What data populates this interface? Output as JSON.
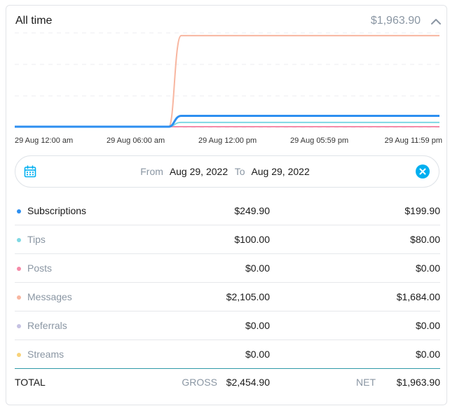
{
  "header": {
    "title": "All time",
    "total": "$1,963.90"
  },
  "chart_data": {
    "type": "line",
    "x_ticks": [
      "29 Aug 12:00 am",
      "29 Aug 06:00 am",
      "29 Aug 12:00 pm",
      "29 Aug 05:59 pm",
      "29 Aug 11:59 pm"
    ],
    "x": [
      "29 Aug 12:00 am",
      "29 Aug 06:00 am",
      "29 Aug 08:00 am",
      "29 Aug 10:00 am",
      "29 Aug 12:00 pm",
      "29 Aug 05:59 pm",
      "29 Aug 11:59 pm"
    ],
    "ylim": [
      0,
      2200
    ],
    "grid": true,
    "series": [
      {
        "name": "Messages",
        "color": "#f8b6a0",
        "values": [
          0,
          0,
          0,
          2105,
          2105,
          2105,
          2105
        ]
      },
      {
        "name": "Subscriptions",
        "color": "#2d8ff0",
        "values": [
          0,
          0,
          0,
          249.9,
          249.9,
          249.9,
          249.9
        ]
      },
      {
        "name": "Tips",
        "color": "#7fd8e3",
        "values": [
          0,
          0,
          0,
          100,
          100,
          100,
          100
        ]
      },
      {
        "name": "Posts",
        "color": "#f58aa8",
        "values": [
          0,
          0,
          0,
          0,
          0,
          0,
          0
        ]
      }
    ]
  },
  "daterange": {
    "from_label": "From",
    "from_value": "Aug 29, 2022",
    "to_label": "To",
    "to_value": "Aug 29, 2022",
    "calendar_icon": "calendar-icon",
    "clear_icon": "close-circle-icon"
  },
  "rows": [
    {
      "name": "Subscriptions",
      "color": "#2d8ff0",
      "name_color": "#1a1a1a",
      "gross": "$249.90",
      "net": "$199.90"
    },
    {
      "name": "Tips",
      "color": "#7fd8e3",
      "name_color": "#8a96a3",
      "gross": "$100.00",
      "net": "$80.00"
    },
    {
      "name": "Posts",
      "color": "#f58aa8",
      "name_color": "#8a96a3",
      "gross": "$0.00",
      "net": "$0.00"
    },
    {
      "name": "Messages",
      "color": "#f8b6a0",
      "name_color": "#8a96a3",
      "gross": "$2,105.00",
      "net": "$1,684.00"
    },
    {
      "name": "Referrals",
      "color": "#c6c2e3",
      "name_color": "#8a96a3",
      "gross": "$0.00",
      "net": "$0.00"
    },
    {
      "name": "Streams",
      "color": "#f8d27a",
      "name_color": "#8a96a3",
      "gross": "$0.00",
      "net": "$0.00"
    }
  ],
  "totals": {
    "label": "TOTAL",
    "gross_label": "GROSS",
    "gross_value": "$2,454.90",
    "net_label": "NET",
    "net_value": "$1,963.90"
  },
  "colors": {
    "accent": "#00aff0",
    "muted": "#8a96a3",
    "divider_accent": "#2e9aa8"
  }
}
